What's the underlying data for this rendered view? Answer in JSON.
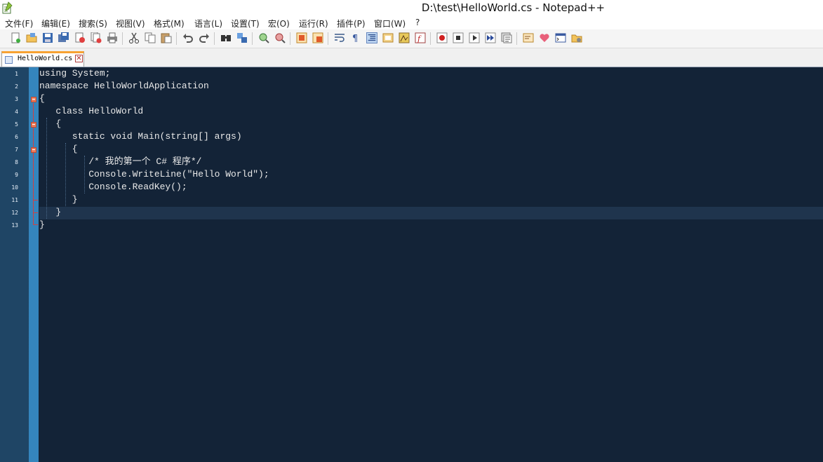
{
  "window": {
    "title": "D:\\test\\HelloWorld.cs - Notepad++"
  },
  "menu": [
    {
      "label": "文件(F)"
    },
    {
      "label": "编辑(E)"
    },
    {
      "label": "搜索(S)"
    },
    {
      "label": "视图(V)"
    },
    {
      "label": "格式(M)"
    },
    {
      "label": "语言(L)"
    },
    {
      "label": "设置(T)"
    },
    {
      "label": "宏(O)"
    },
    {
      "label": "运行(R)"
    },
    {
      "label": "插件(P)"
    },
    {
      "label": "窗口(W)"
    },
    {
      "label": "?"
    }
  ],
  "tabs": [
    {
      "label": "HelloWorld.cs",
      "active": true
    }
  ],
  "editor": {
    "lines": [
      {
        "num": "1",
        "text": "using System;"
      },
      {
        "num": "2",
        "text": "namespace HelloWorldApplication"
      },
      {
        "num": "3",
        "text": "{"
      },
      {
        "num": "4",
        "text": "   class HelloWorld"
      },
      {
        "num": "5",
        "text": "   {"
      },
      {
        "num": "6",
        "text": "      static void Main(string[] args)"
      },
      {
        "num": "7",
        "text": "      {"
      },
      {
        "num": "8",
        "text": "         /* 我的第一个 C# 程序*/"
      },
      {
        "num": "9",
        "text": "         Console.WriteLine(\"Hello World\");"
      },
      {
        "num": "10",
        "text": "         Console.ReadKey();"
      },
      {
        "num": "11",
        "text": "      }"
      },
      {
        "num": "12",
        "text": "   }"
      },
      {
        "num": "13",
        "text": "}"
      }
    ],
    "current_line": 12
  },
  "colors": {
    "editor_bg": "#132337",
    "gutter_bg": "#1f4565",
    "fold_margin": "#3a8bc2",
    "text": "#e8e8e8",
    "fold_marker": "#ec7b5a",
    "tab_accent": "#f7a233"
  }
}
